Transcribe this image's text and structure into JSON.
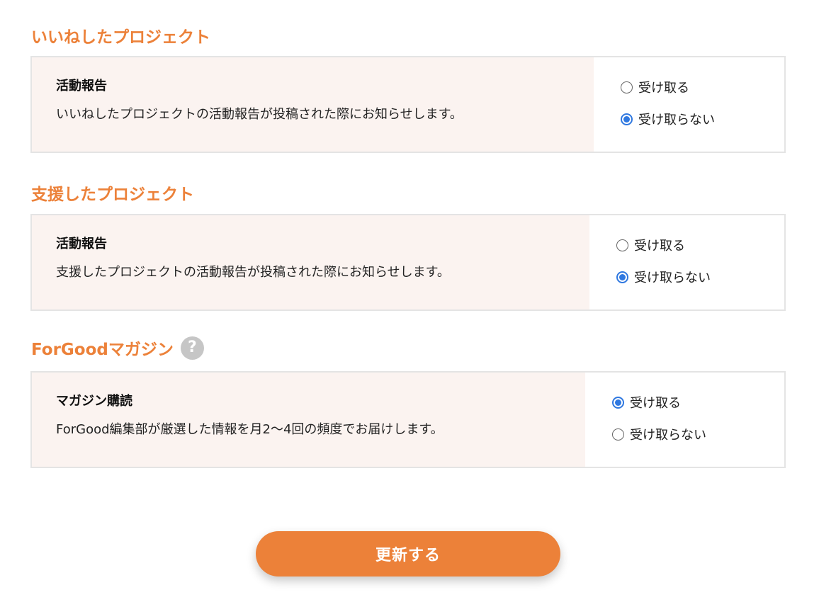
{
  "sections": [
    {
      "title": "いいねしたプロジェクト",
      "label": "活動報告",
      "description": "いいねしたプロジェクトの活動報告が投稿された際にお知らせします。",
      "options": [
        "受け取る",
        "受け取らない"
      ],
      "selected": "受け取らない"
    },
    {
      "title": "支援したプロジェクト",
      "label": "活動報告",
      "description": "支援したプロジェクトの活動報告が投稿された際にお知らせします。",
      "options": [
        "受け取る",
        "受け取らない"
      ],
      "selected": "受け取らない"
    },
    {
      "title": "ForGoodマガジン",
      "help_icon": "question-mark",
      "help_glyph": "?",
      "label": "マガジン購読",
      "description": "ForGood編集部が厳選した情報を月2〜4回の頻度でお届けします。",
      "options": [
        "受け取る",
        "受け取らない"
      ],
      "selected": "受け取る"
    }
  ],
  "submit": {
    "label": "更新する"
  },
  "colors": {
    "accent": "#ec8139",
    "card_desc_bg": "#fbf3f0",
    "card_border": "#e4e4e4",
    "radio_selected": "#2f78e0",
    "help_icon_bg": "#c6c6c6"
  }
}
